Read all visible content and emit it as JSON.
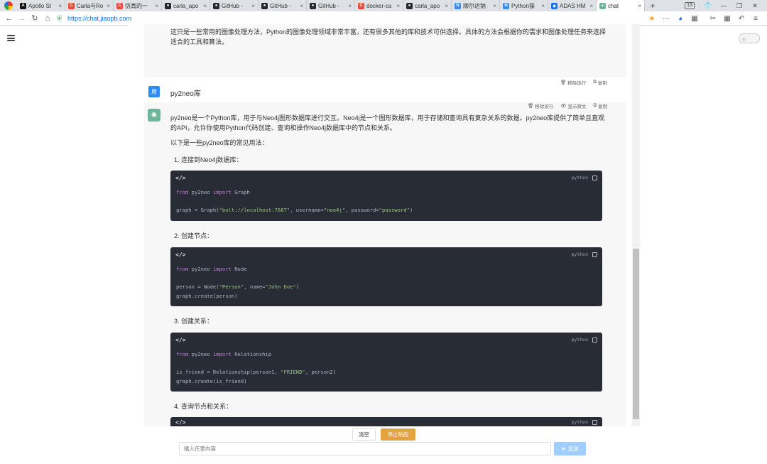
{
  "browser": {
    "tabs": [
      {
        "label": "Apollo St",
        "favicon_color": "#111111",
        "favicon_glyph": "A"
      },
      {
        "label": "Carla与Ro",
        "favicon_color": "#e74c3c",
        "favicon_glyph": "C"
      },
      {
        "label": "仿真的一",
        "favicon_color": "#e74c3c",
        "favicon_glyph": "C"
      },
      {
        "label": "carla_apo",
        "favicon_color": "#24292e",
        "favicon_glyph": "●"
      },
      {
        "label": "GitHub - ",
        "favicon_color": "#24292e",
        "favicon_glyph": "●"
      },
      {
        "label": "GitHub - ",
        "favicon_color": "#24292e",
        "favicon_glyph": "●"
      },
      {
        "label": "GitHub - ",
        "favicon_color": "#24292e",
        "favicon_glyph": "●"
      },
      {
        "label": "docker-ca",
        "favicon_color": "#e74c3c",
        "favicon_glyph": "C"
      },
      {
        "label": "carla_apo",
        "favicon_color": "#24292e",
        "favicon_glyph": "●"
      },
      {
        "label": "顺尔达钠",
        "favicon_color": "#3a8ee6",
        "favicon_glyph": "N"
      },
      {
        "label": "Python操",
        "favicon_color": "#3a8ee6",
        "favicon_glyph": "N"
      },
      {
        "label": "ADAS HM",
        "favicon_color": "#1e6fe8",
        "favicon_glyph": "◆"
      },
      {
        "label": "chat",
        "favicon_color": "#6db69b",
        "favicon_glyph": "✦",
        "active": true
      }
    ],
    "new_tab_glyph": "+",
    "tab_close_glyph": "×",
    "tab_count": "13",
    "url": "https://chat.jiaopb.com",
    "window_controls": [
      "👕",
      "—",
      "❐",
      "✕"
    ]
  },
  "conversation": {
    "prev_answer_text": "这只是一些常用的图像处理方法，Python的图像处理领域非常丰富，还有很多其他的库和技术可供选择。具体的方法会根据你的需求和图像处理任务来选择适合的工具和算法。",
    "prev_actions": {
      "remove": "移除该行",
      "copy": "复制"
    },
    "user_avatar": "用",
    "user_question": "py2neo库",
    "answer_actions": {
      "remove": "移除该行",
      "show_raw": "显示原文",
      "copy": "复制"
    },
    "answer_intro": "py2neo是一个Python库，用于与Neo4j图形数据库进行交互。Neo4j是一个图形数据库，用于存储和查询具有复杂关系的数据。py2neo库提供了简单且直观的API，允许你使用Python代码创建、查询和操作Neo4j数据库中的节点和关系。",
    "answer_usage": "以下是一些py2neo库的常见用法：",
    "steps": [
      "1. 连接到Neo4j数据库：",
      "2. 创建节点：",
      "3. 创建关系：",
      "4. 查询节点和关系："
    ],
    "code_lang": "python",
    "code_icon": "</>",
    "code_blocks": [
      {
        "import_kw1": "from",
        "import_mod": "py2neo",
        "import_kw2": "import",
        "import_name": "Graph",
        "line2_a": "graph = Graph(",
        "line2_s1": "\"bolt://localhost:7687\"",
        "line2_b": ", username=",
        "line2_s2": "\"neo4j\"",
        "line2_c": ", password=",
        "line2_s3": "\"password\"",
        "line2_d": ")"
      },
      {
        "import_kw1": "from",
        "import_mod": "py2neo",
        "import_kw2": "import",
        "import_name": "Node",
        "line2_a": "person = Node(",
        "line2_s1": "\"Person\"",
        "line2_b": ", name=",
        "line2_s2": "\"John Doe\"",
        "line2_c": ")",
        "line3": "graph.create(person)"
      },
      {
        "import_kw1": "from",
        "import_mod": "py2neo",
        "import_kw2": "import",
        "import_name": "Relationship",
        "line2_a": "is_friend = Relationship(person1, ",
        "line2_s1": "\"FRIEND\"",
        "line2_b": ", person2)",
        "line3": "graph.create(is_friend)"
      }
    ]
  },
  "composer": {
    "clear_label": "清空",
    "stop_label": "停止响应",
    "placeholder": "输入任意内容",
    "send_label": "发送"
  }
}
